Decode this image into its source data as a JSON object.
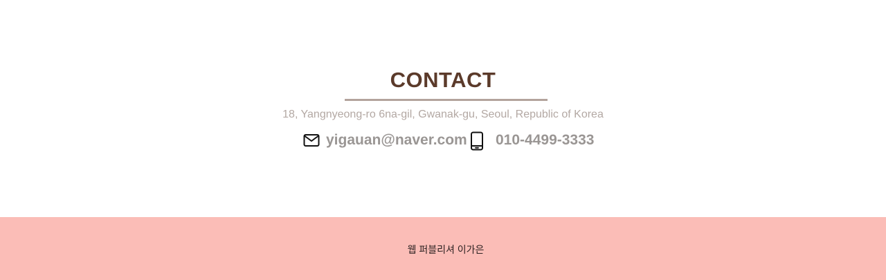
{
  "contact": {
    "title": "CONTACT",
    "address": "18, Yangnyeong-ro 6na-gil, Gwanak-gu, Seoul, Republic of Korea",
    "email": "yigauan@naver.com",
    "phone": "010-4499-3333",
    "email_icon": "mail-icon",
    "phone_icon": "smartphone-icon"
  },
  "footer": {
    "text": "웹 퍼블리셔 이가은"
  },
  "colors": {
    "title": "#5b3a2a",
    "underline": "#b3a39c",
    "muted_text": "#b3a8a3",
    "contact_text": "#9a9694",
    "footer_bg": "#fbbdb7",
    "footer_text": "#2d2222"
  }
}
